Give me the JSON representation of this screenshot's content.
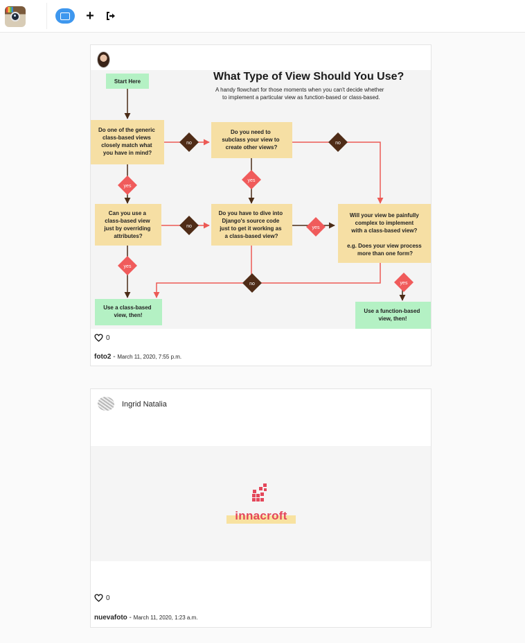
{
  "nav": {
    "logo_icon": "instagram-camera-icon",
    "items": [
      {
        "icon": "explore-screen-icon",
        "color": "#3e97ee"
      },
      {
        "icon": "plus-icon"
      },
      {
        "icon": "logout-icon"
      }
    ]
  },
  "posts": [
    {
      "author": "",
      "likes": "0",
      "title": "foto2",
      "separator": " - ",
      "date": "March 11, 2020, 7:55 p.m.",
      "flowchart": {
        "title": "What Type of View Should You Use?",
        "subtitle_line1": "A handy flowchart for those moments when you can't decide whether",
        "subtitle_line2": "to implement a particular view as function-based or class-based.",
        "start": "Start Here",
        "q1": [
          "Do one of the generic",
          "class-based views",
          "closely match what",
          "you have in mind?"
        ],
        "q2": [
          "Do you need to",
          "subclass your view to",
          "create other views?"
        ],
        "q3": [
          "Can you use a",
          "class-based view",
          "just by overriding",
          "attributes?"
        ],
        "q4": [
          "Do you have to dive into",
          "Django's source code",
          "just to get it working as",
          "a class-based view?"
        ],
        "q5": [
          "Will your view be painfully",
          "complex to implement",
          "with a class-based view?",
          "",
          "e.g. Does your view process",
          "more than one form?"
        ],
        "r1": [
          "Use a class-based",
          "view, then!"
        ],
        "r2": [
          "Use a function-based",
          "view, then!"
        ],
        "yes": "yes",
        "no": "no",
        "colors": {
          "question": "#f6dfa4",
          "result": "#b4f1c4",
          "yes": "#f05b5b",
          "no": "#4f2c17",
          "arrow_red": "#ec5a55",
          "arrow_dark": "#4b2c17"
        }
      }
    },
    {
      "author": "Ingrid Natalia",
      "likes": "0",
      "title": "nuevafoto",
      "separator": " - ",
      "date": "March 11, 2020, 1:23 a.m.",
      "brand": "innacroft"
    }
  ]
}
